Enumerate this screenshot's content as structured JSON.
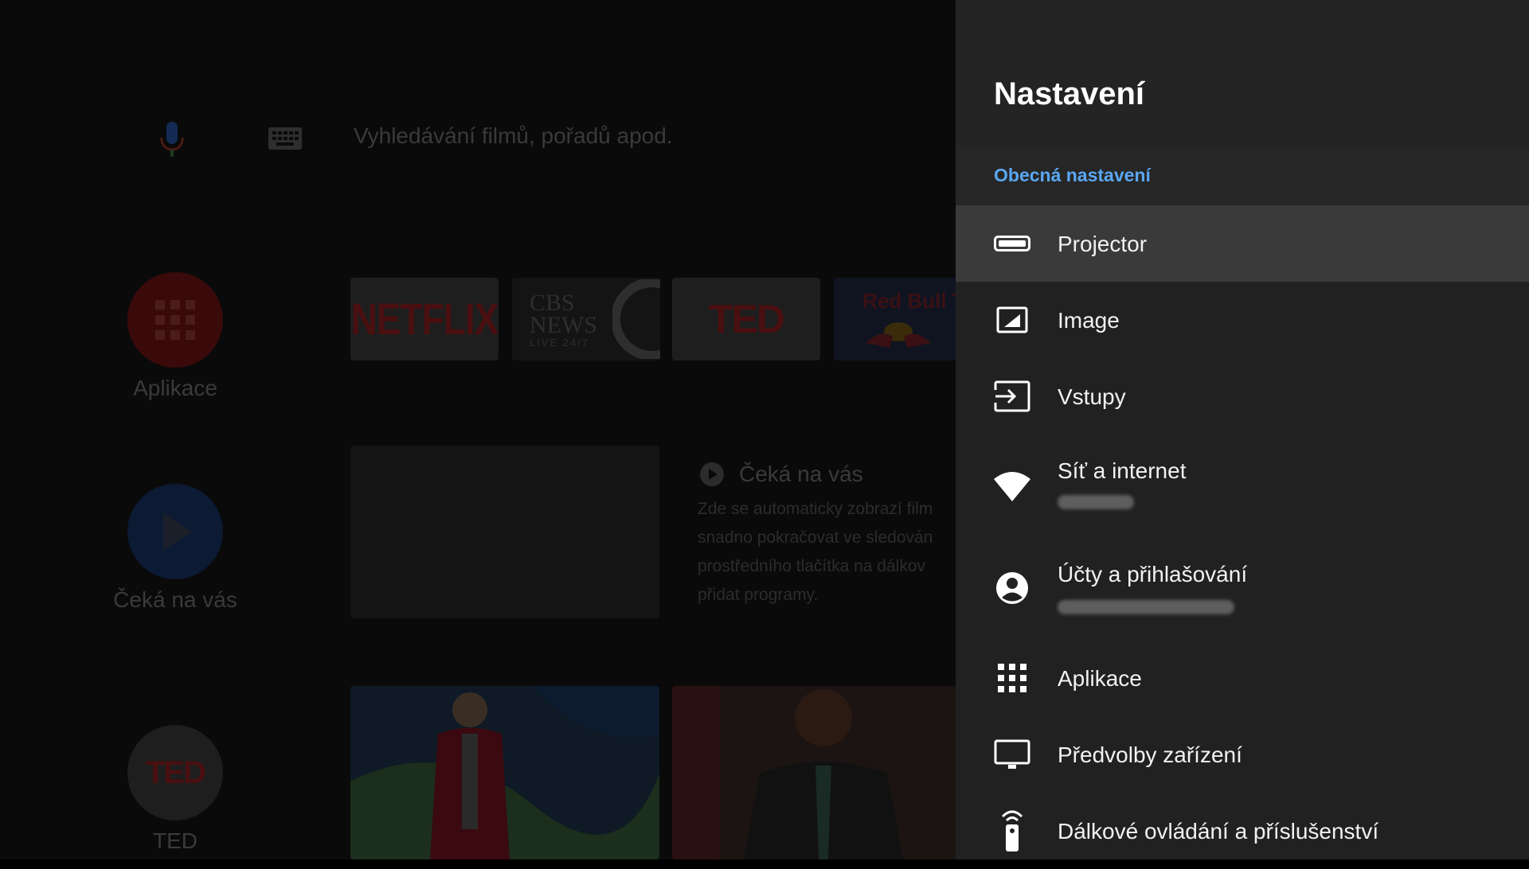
{
  "home": {
    "search_placeholder": "Vyhledávání filmů, pořadů apod.",
    "side": {
      "apps_label": "Aplikace",
      "waiting_label": "Čeká na vás",
      "ted_label": "TED",
      "ted_logo": "TED"
    },
    "channels": {
      "netflix": "NETFLIX",
      "cbs": "CBS NEWS",
      "cbs_sub": "LIVE 24/7",
      "ted": "TED",
      "redbull": "Red Bull TV"
    },
    "waiting": {
      "title": "Čeká na vás",
      "desc_lines": [
        "Zde se automaticky zobrazí film",
        "snadno pokračovat ve sledován",
        "prostředního tlačítka na dálkov",
        "přidat programy."
      ]
    }
  },
  "settings": {
    "title": "Nastavení",
    "section": "Obecná nastavení",
    "items": [
      {
        "label": "Projector",
        "icon": "projector-icon"
      },
      {
        "label": "Image",
        "icon": "image-icon"
      },
      {
        "label": "Vstupy",
        "icon": "input-icon"
      },
      {
        "label": "Síť a internet",
        "icon": "wifi-icon"
      },
      {
        "label": "Účty a přihlašování",
        "icon": "account-icon"
      },
      {
        "label": "Aplikace",
        "icon": "apps-grid-icon"
      },
      {
        "label": "Předvolby zařízení",
        "icon": "monitor-icon"
      },
      {
        "label": "Dálkové ovládání a příslušenství",
        "icon": "remote-icon"
      }
    ]
  },
  "colors": {
    "accent": "#5aa7f2",
    "panel_bg": "#212121",
    "focused_bg": "#3a3a3a"
  }
}
